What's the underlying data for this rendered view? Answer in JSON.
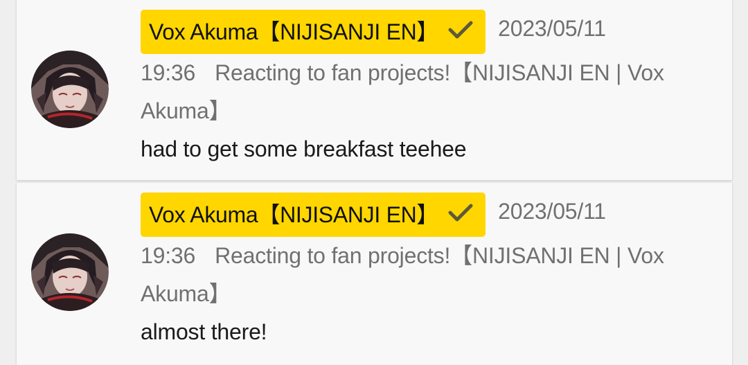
{
  "comments": [
    {
      "author": "Vox Akuma【NIJISANJI EN】",
      "verified_icon": "checkmark-icon",
      "date": "2023/05/11",
      "time": "19:36",
      "video_title": "Reacting to fan projects!【NIJISANJI EN | Vox Akuma】",
      "message": "had to get some breakfast teehee"
    },
    {
      "author": "Vox Akuma【NIJISANJI EN】",
      "verified_icon": "checkmark-icon",
      "date": "2023/05/11",
      "time": "19:36",
      "video_title": "Reacting to fan projects!【NIJISANJI EN | Vox Akuma】",
      "message": "almost there!"
    }
  ],
  "colors": {
    "author_highlight": "#ffd600",
    "card_background": "#f8f8f8",
    "meta_text": "#707070",
    "message_text": "#1a1a1a"
  }
}
